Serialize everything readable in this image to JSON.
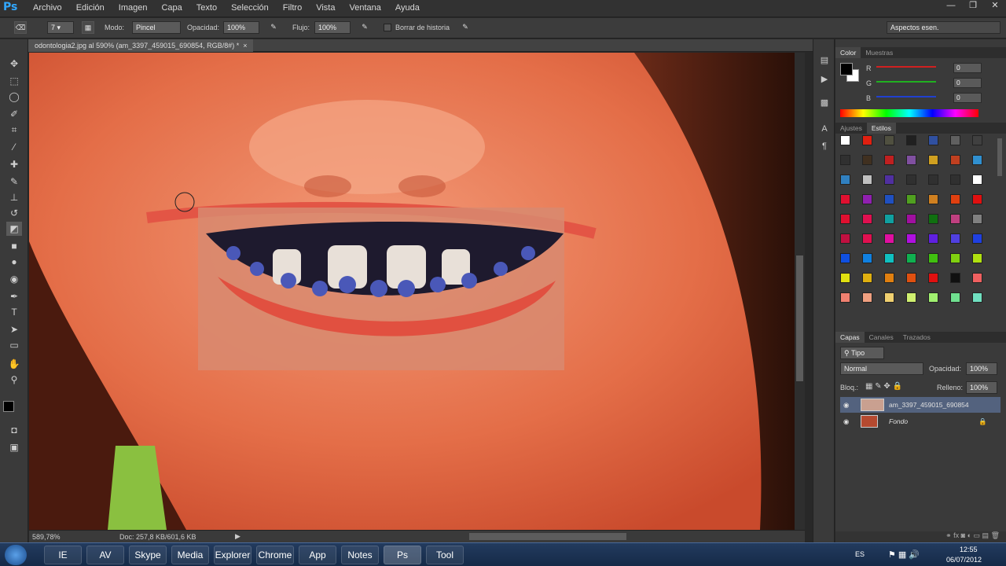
{
  "menubar": {
    "logo": "Ps",
    "items": [
      "Archivo",
      "Edición",
      "Imagen",
      "Capa",
      "Texto",
      "Selección",
      "Filtro",
      "Vista",
      "Ventana",
      "Ayuda"
    ],
    "window_controls": [
      "—",
      "❐",
      "✕"
    ]
  },
  "options": {
    "brush_size": "7",
    "mode_label": "Modo:",
    "mode_value": "Pincel",
    "opacity_label": "Opacidad:",
    "opacity_value": "100%",
    "flow_label": "Flujo:",
    "flow_value": "100%",
    "history_label": "Borrar de historia",
    "workspace": "Aspectos esen."
  },
  "document": {
    "tab_title": "odontologia2.jpg al 590% (am_3397_459015_690854, RGB/8#) *",
    "close": "×"
  },
  "status": {
    "zoom": "589,78%",
    "doc": "Doc: 257,8 KB/601,6 KB"
  },
  "color_panel": {
    "tabs": [
      "Color",
      "Muestras"
    ],
    "channels": [
      {
        "label": "R",
        "value": "0",
        "color": "#d02020"
      },
      {
        "label": "G",
        "value": "0",
        "color": "#20b020"
      },
      {
        "label": "B",
        "value": "0",
        "color": "#2040d0"
      }
    ]
  },
  "styles_panel": {
    "tabs": [
      "Ajustes",
      "Estilos"
    ],
    "swatch_colors": [
      [
        "#ffffff",
        "#e02010",
        "#505040",
        "#202020",
        "#3050a0",
        "#606060",
        "#404040"
      ],
      [
        "#303030",
        "#403020",
        "#c02020",
        "#8050a0",
        "#d0a020",
        "#c04020",
        "#3090d0"
      ],
      [
        "#3080c0",
        "#c0c0c0",
        "#5030a0",
        "#303030",
        "#303030",
        "#303030",
        "#ffffff"
      ],
      [
        "#e01030",
        "#9020b0",
        "#2050c0",
        "#50a020",
        "#d08020",
        "#e04010",
        "#e01010"
      ],
      [
        "#e01030",
        "#e01050",
        "#10a0a0",
        "#a010a0",
        "#107010",
        "#c04080",
        "#808080"
      ],
      [
        "#c01040",
        "#e01050",
        "#e010a0",
        "#b010e0",
        "#6020e0",
        "#5040e0",
        "#2040e0"
      ],
      [
        "#1050e0",
        "#1080e0",
        "#10c0c0",
        "#10b050",
        "#40c010",
        "#80d010",
        "#b0e010"
      ],
      [
        "#e0e010",
        "#e0b010",
        "#e08010",
        "#e05010",
        "#e01010",
        "#101010",
        "#f06060"
      ],
      [
        "#f08070",
        "#f0a080",
        "#f0d070",
        "#d0f070",
        "#a0f070",
        "#70e090",
        "#70e0c0"
      ]
    ]
  },
  "layers_panel": {
    "tabs": [
      "Capas",
      "Canales",
      "Trazados"
    ],
    "kind_filter": "Tipo",
    "blend_mode": "Normal",
    "opacity_label": "Opacidad:",
    "opacity_value": "100%",
    "lock_label": "Bloq.:",
    "fill_label": "Relleno:",
    "fill_value": "100%",
    "layers": [
      {
        "name": "am_3397_459015_690854",
        "selected": true
      },
      {
        "name": "Fondo",
        "selected": false
      }
    ]
  },
  "taskbar": {
    "apps": [
      "IE",
      "AV",
      "Skype",
      "Media",
      "Explorer",
      "Chrome",
      "App",
      "Notes",
      "Ps",
      "Tool"
    ],
    "lang": "ES",
    "time": "12:55",
    "date": "06/07/2012"
  }
}
